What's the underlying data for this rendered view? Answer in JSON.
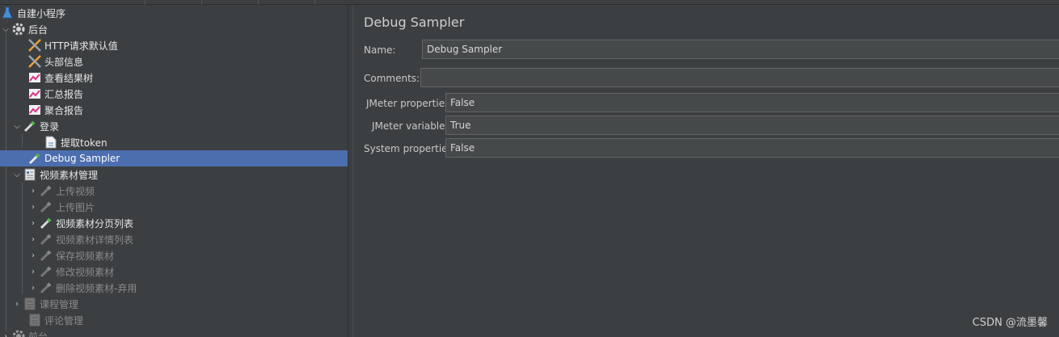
{
  "tree": {
    "items": [
      {
        "label": "自建小程序",
        "icon": "flask-icon"
      },
      {
        "label": "后台",
        "icon": "gear-icon"
      },
      {
        "label": "HTTP请求默认值",
        "icon": "tools-icon"
      },
      {
        "label": "头部信息",
        "icon": "tools-icon"
      },
      {
        "label": "查看结果树",
        "icon": "graph-icon"
      },
      {
        "label": "汇总报告",
        "icon": "graph-icon"
      },
      {
        "label": "聚合报告",
        "icon": "graph-icon"
      },
      {
        "label": "登录",
        "icon": "pipette-icon"
      },
      {
        "label": "提取token",
        "icon": "document-icon"
      },
      {
        "label": "Debug Sampler",
        "icon": "pipette-icon"
      },
      {
        "label": "视频素材管理",
        "icon": "controller-icon"
      },
      {
        "label": "上传视频",
        "icon": "pipette-disabled-icon"
      },
      {
        "label": "上传图片",
        "icon": "pipette-disabled-icon"
      },
      {
        "label": "视频素材分页列表",
        "icon": "pipette-icon"
      },
      {
        "label": "视频素材详情列表",
        "icon": "pipette-disabled-icon"
      },
      {
        "label": "保存视频素材",
        "icon": "pipette-disabled-icon"
      },
      {
        "label": "修改视频素材",
        "icon": "pipette-disabled-icon"
      },
      {
        "label": "删除视频素材-弃用",
        "icon": "pipette-disabled-icon"
      },
      {
        "label": "课程管理",
        "icon": "controller-disabled-icon"
      },
      {
        "label": "评论管理",
        "icon": "controller-disabled-icon"
      },
      {
        "label": "前台",
        "icon": "gear-icon"
      }
    ]
  },
  "panel": {
    "title": "Debug Sampler",
    "name_label": "Name:",
    "name_value": "Debug Sampler",
    "comments_label": "Comments:",
    "comments_value": "",
    "jmeter_props_label": "JMeter properties:",
    "jmeter_props_value": "False",
    "jmeter_vars_label": "JMeter variables:",
    "jmeter_vars_value": "True",
    "system_props_label": "System properties:",
    "system_props_value": "False"
  },
  "watermark": "CSDN @流墨馨",
  "colors": {
    "background": "#3c3f41",
    "selection": "#4b6eaf",
    "field": "#45494a"
  }
}
